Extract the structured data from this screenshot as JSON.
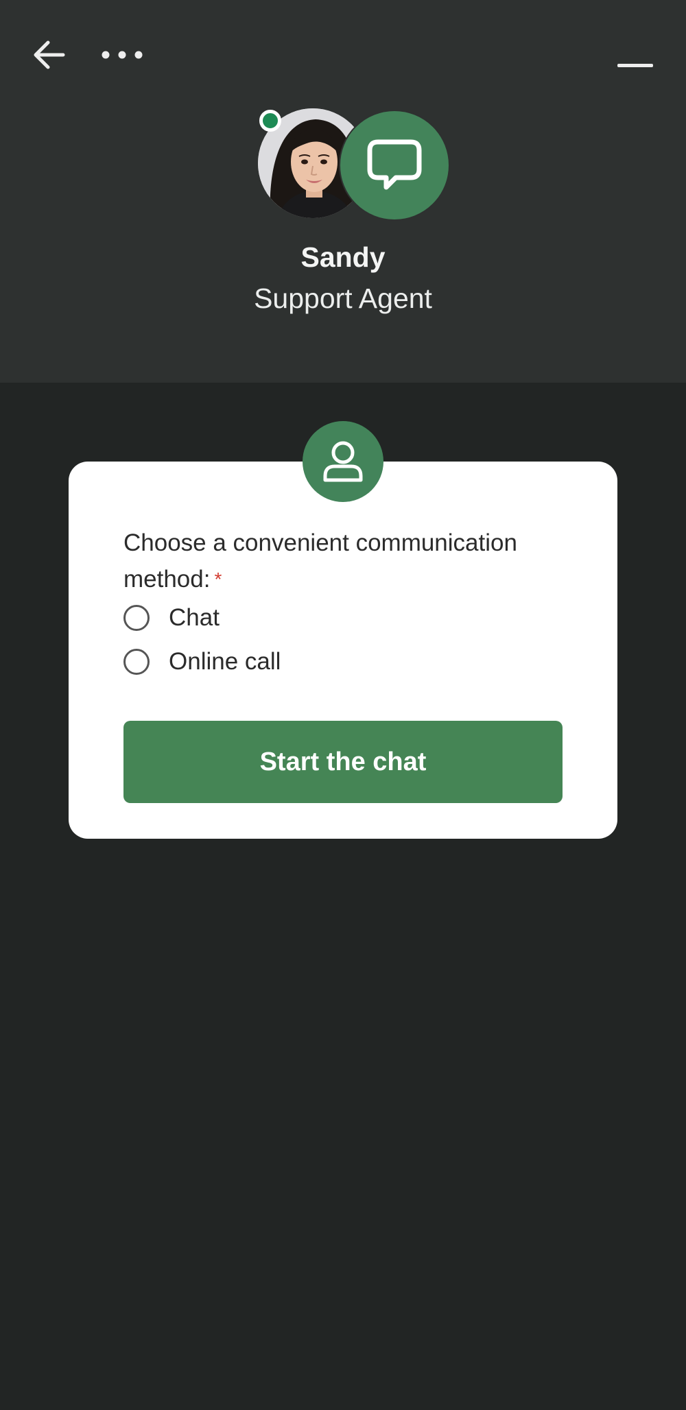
{
  "header": {
    "agent_name": "Sandy",
    "agent_role": "Support Agent",
    "status": "online",
    "icons": {
      "back": "back-arrow-icon",
      "more": "more-options-icon",
      "minimize": "minimize-icon",
      "bot": "chat-bubble-icon"
    }
  },
  "form": {
    "question": "Choose a convenient communication method:",
    "required_mark": "*",
    "options": [
      {
        "label": "Chat",
        "selected": false
      },
      {
        "label": "Online call",
        "selected": false
      }
    ],
    "submit_label": "Start the chat",
    "icon": "user-icon"
  },
  "colors": {
    "accent": "#458555",
    "status_online": "#1d8a54",
    "required": "#d23b30",
    "header_bg": "#2e3130",
    "page_bg": "#222524"
  }
}
